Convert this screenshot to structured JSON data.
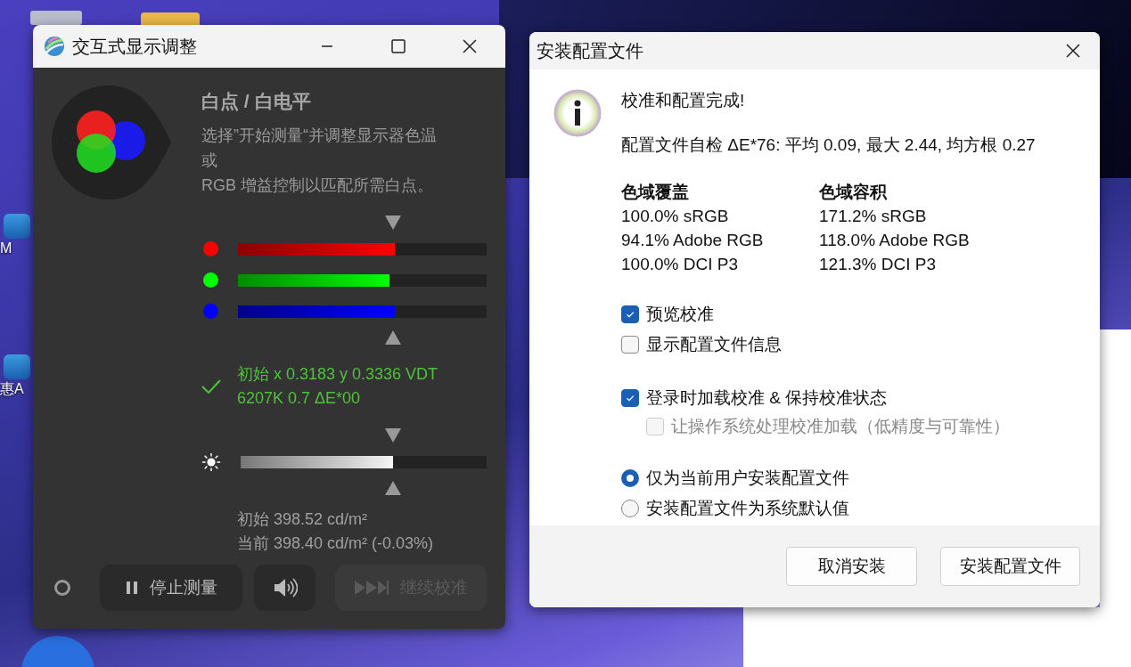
{
  "desktop": {
    "icons": [
      {
        "label": "M"
      },
      {
        "label": "惠A"
      }
    ]
  },
  "adjust_window": {
    "title": "交互式显示调整",
    "heading": "白点 / 白电平",
    "description": [
      "选择”开始测量“并调整显示器色温",
      "或",
      "RGB 增益控制以匹配所需白点。"
    ],
    "channels": [
      {
        "color": "#ff0000",
        "level": 0.63
      },
      {
        "color": "#00ff00",
        "level": 0.61
      },
      {
        "color": "#0000ff",
        "level": 0.63
      }
    ],
    "status": {
      "ok": true,
      "lines": [
        "初始 x 0.3183 y 0.3336 VDT",
        "6207K 0.7 ΔE*00"
      ]
    },
    "brightness": {
      "level": 0.62
    },
    "luminance": [
      "初始 398.52 cd/m²",
      "当前 398.40 cd/m² (-0.03%)"
    ],
    "buttons": [
      {
        "kind": "pause",
        "label": "停止测量",
        "disabled": false
      },
      {
        "kind": "sound",
        "disabled": false
      },
      {
        "kind": "skip",
        "label": "继续校准",
        "disabled": true
      }
    ]
  },
  "install_dialog": {
    "title": "安装配置文件",
    "message": "校准和配置完成!",
    "self_check": "配置文件自检 ΔE*76: 平均 0.09, 最大 2.44, 均方根 0.27",
    "gamut": [
      {
        "heading": "色域覆盖",
        "lines": [
          "100.0% sRGB",
          "94.1% Adobe RGB",
          "100.0% DCI P3"
        ]
      },
      {
        "heading": "色域容积",
        "lines": [
          "171.2% sRGB",
          "118.0% Adobe RGB",
          "121.3% DCI P3"
        ]
      }
    ],
    "checkbox_groups": [
      [
        {
          "label": "预览校准",
          "checked": true,
          "disabled": false
        },
        {
          "label": "显示配置文件信息",
          "checked": false,
          "disabled": false
        }
      ],
      [
        {
          "label": "登录时加载校准 & 保持校准状态",
          "checked": true,
          "disabled": false,
          "children": [
            {
              "label": "让操作系统处理校准加载（低精度与可靠性）",
              "checked": false,
              "disabled": true
            }
          ]
        }
      ]
    ],
    "radios": [
      {
        "label": "仅为当前用户安装配置文件",
        "selected": true
      },
      {
        "label": "安装配置文件为系统默认值",
        "selected": false
      }
    ],
    "buttons": [
      "取消安装",
      "安装配置文件"
    ]
  }
}
